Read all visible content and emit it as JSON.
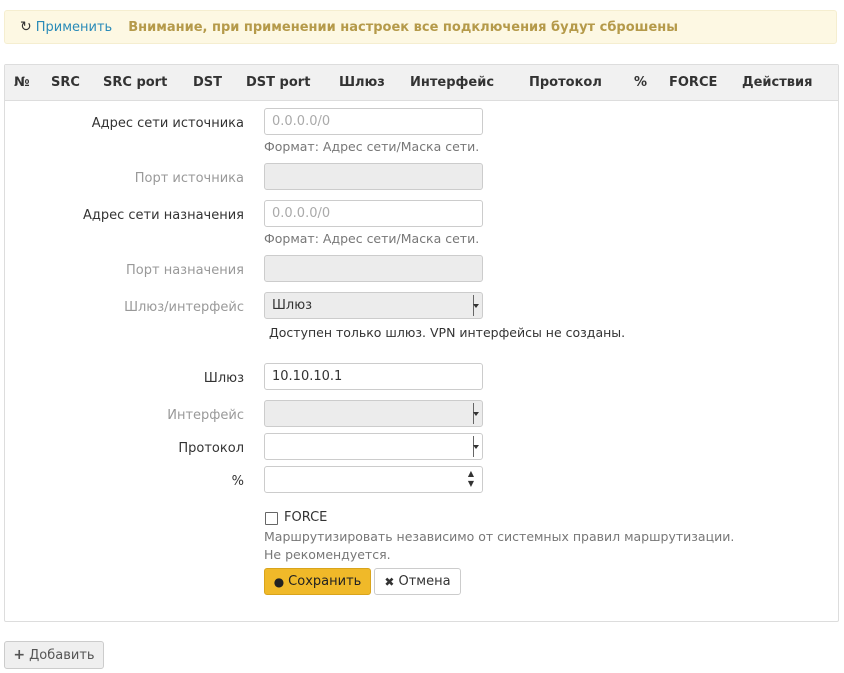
{
  "alert": {
    "apply_label": "Применить",
    "apply_icon": "refresh-icon",
    "message": "Внимание, при применении настроек все подключения будут сброшены"
  },
  "table": {
    "headers": [
      "№",
      "SRC",
      "SRC port",
      "DST",
      "DST port",
      "Шлюз",
      "Интерфейс",
      "Протокол",
      "%",
      "FORCE",
      "Действия"
    ]
  },
  "form": {
    "src_net": {
      "label": "Адрес сети источника",
      "placeholder": "0.0.0.0/0",
      "help": "Формат: Адрес сети/Маска сети."
    },
    "src_port": {
      "label": "Порт источника"
    },
    "dst_net": {
      "label": "Адрес сети назначения",
      "placeholder": "0.0.0.0/0",
      "help": "Формат: Адрес сети/Маска сети."
    },
    "dst_port": {
      "label": "Порт назначения"
    },
    "gw_iface": {
      "label": "Шлюз/интерфейс",
      "value": "Шлюз",
      "help": "Доступен только шлюз. VPN интерфейсы не созданы."
    },
    "gateway": {
      "label": "Шлюз",
      "value": "10.10.10.1"
    },
    "interface": {
      "label": "Интерфейс",
      "value": ""
    },
    "protocol": {
      "label": "Протокол",
      "value": ""
    },
    "percent": {
      "label": "%",
      "value": ""
    },
    "force": {
      "label": "FORCE",
      "checked": false,
      "help": "Маршрутизировать независимо от системных правил маршрутизации. Не рекомендуется."
    },
    "save_label": "Сохранить",
    "cancel_label": "Отмена"
  },
  "add_label": "Добавить",
  "colors": {
    "accent": "#f0b929",
    "link": "#2a8bb8",
    "warning_text": "#b59a4a"
  }
}
